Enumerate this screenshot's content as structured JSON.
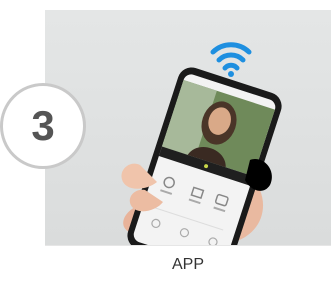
{
  "step": {
    "number": "3",
    "caption": "APP"
  },
  "image": {
    "content": "hand-holding-phone-video-call",
    "icons": [
      "wifi-icon",
      "answer-call-icon",
      "unlock-icon",
      "snapshot-icon"
    ]
  },
  "colors": {
    "wifi": "#1e8fe0",
    "badge_border": "#c9c9c9",
    "badge_text": "#555555",
    "panel_bg": "#dfe1e1",
    "caption_text": "#333333"
  }
}
